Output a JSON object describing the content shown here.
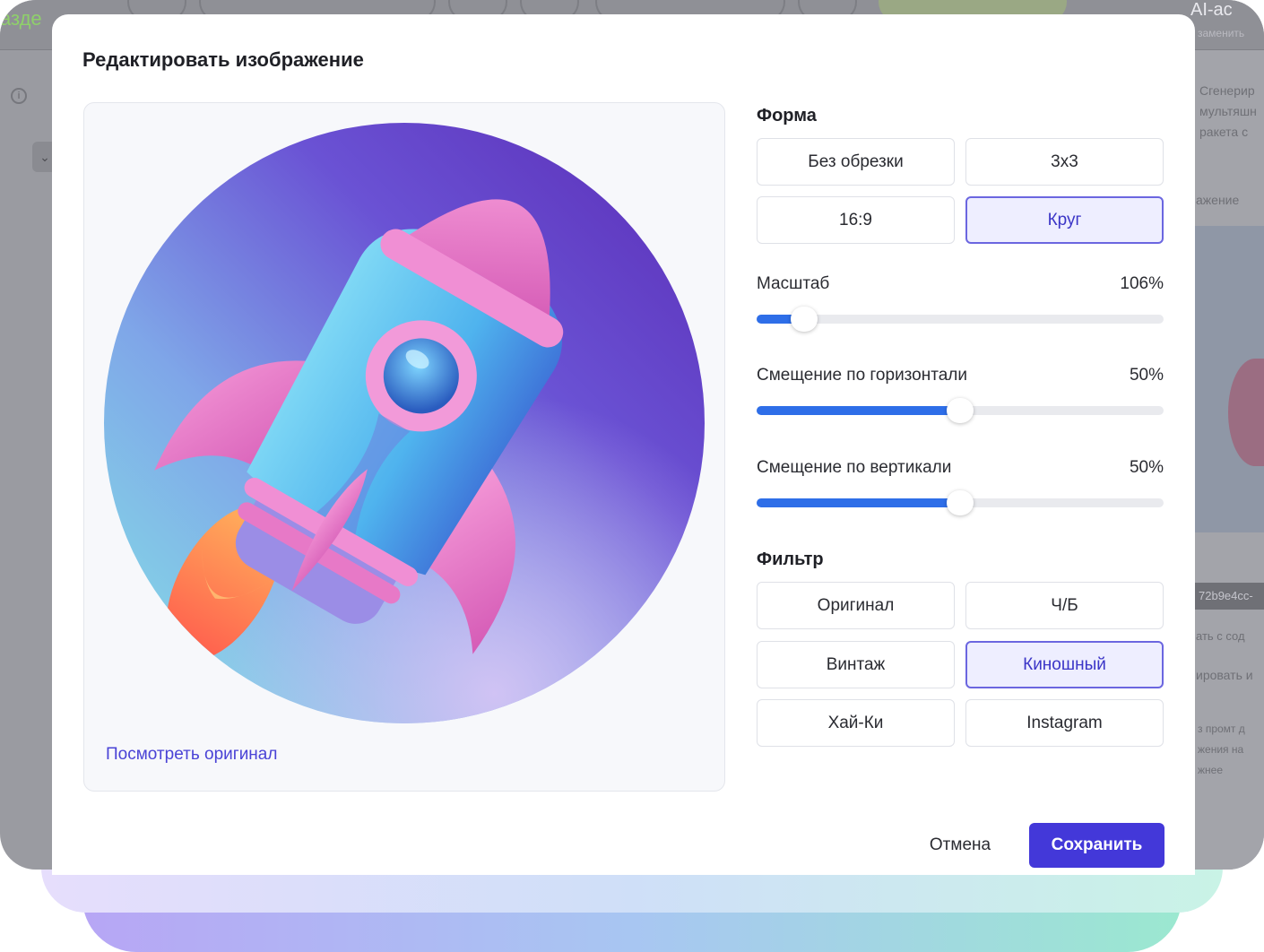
{
  "background_app": {
    "logo_text": "азде",
    "title": "AI-ас",
    "subtitle": "заменить",
    "right_lines": [
      "Сгенерир",
      "мультяшн",
      "ракета с"
    ],
    "right_label": "ажение",
    "hash": "72b9e4cc-",
    "lower_lines": [
      "ать с сод",
      "ировать и"
    ],
    "faint_lines": [
      "з промт д",
      "жения на",
      "жнее"
    ]
  },
  "modal": {
    "title": "Редактировать изображение",
    "view_original": "Посмотреть оригинал",
    "shape": {
      "title": "Форма",
      "options": [
        "Без обрезки",
        "3х3",
        "16:9",
        "Круг"
      ],
      "selected": "Круг"
    },
    "scale": {
      "label": "Масштаб",
      "value_text": "106%",
      "fraction": 0.06
    },
    "offset_x": {
      "label": "Смещение по горизонтали",
      "value_text": "50%",
      "fraction": 0.5
    },
    "offset_y": {
      "label": "Смещение по вертикали",
      "value_text": "50%",
      "fraction": 0.5
    },
    "filter": {
      "title": "Фильтр",
      "options": [
        "Оригинал",
        "Ч/Б",
        "Винтаж",
        "Киношный",
        "Хай-Ки",
        "Instagram"
      ],
      "selected": "Киношный"
    },
    "cancel_label": "Отмена",
    "save_label": "Сохранить"
  },
  "colors": {
    "accent": "#4338d9",
    "slider_fill": "#2e6ee8",
    "selected_border": "#6b66e0",
    "selected_bg": "#eeeeff",
    "link": "#4a43d6"
  },
  "icons": [
    "info-icon",
    "chevron-down-icon"
  ]
}
